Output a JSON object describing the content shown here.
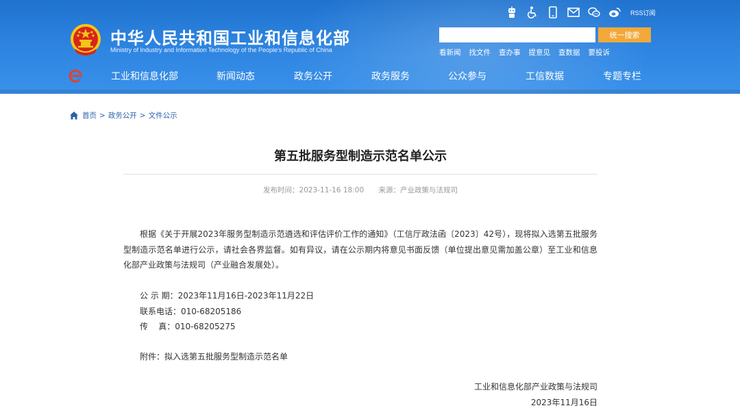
{
  "header": {
    "site_title": "中华人民共和国工业和信息化部",
    "site_subtitle": "Ministry of Industry and Information Technology of the People's Republic of China",
    "top_icons": [
      "robot-assistant-icon",
      "accessibility-icon",
      "mobile-icon",
      "mail-icon",
      "wechat-icon",
      "weibo-icon"
    ],
    "rss_label": "RSS订阅",
    "search": {
      "placeholder": "",
      "value": "",
      "button_label": "统一搜索"
    },
    "quick_links": [
      "看新闻",
      "找文件",
      "查办事",
      "提意见",
      "查数据",
      "要投诉"
    ],
    "nav": [
      "工业和信息化部",
      "新闻动态",
      "政务公开",
      "政务服务",
      "公众参与",
      "工信数据",
      "专题专栏"
    ],
    "colors": {
      "header_blue": "#2f86e2",
      "search_orange": "#f2a83a",
      "emblem_red": "#d7261c",
      "emblem_gold": "#f5c518"
    }
  },
  "breadcrumb": {
    "items": [
      "首页",
      "政务公开",
      "文件公示"
    ],
    "separator": ">"
  },
  "article": {
    "title": "第五批服务型制造示范名单公示",
    "publish_time": "发布时间：2023-11-16 18:00",
    "source": "来源：产业政策与法规司",
    "paragraph": "根据《关于开展2023年服务型制造示范遴选和评估评价工作的通知》（工信厅政法函〔2023〕42号），现将拟入选第五批服务型制造示范名单进行公示，请社会各界监督。如有异议，请在公示期内将意见书面反馈（单位提出意见需加盖公章）至工业和信息化部产业政策与法规司（产业融合发展处）。",
    "period": "公 示 期：2023年11月16日-2023年11月22日",
    "phone": "联系电话：010-68205186",
    "fax": "传    真：010-68205275",
    "attachment": "附件：拟入选第五批服务型制造示范名单",
    "signature": "工业和信息化部产业政策与法规司",
    "date": "2023年11月16日"
  }
}
